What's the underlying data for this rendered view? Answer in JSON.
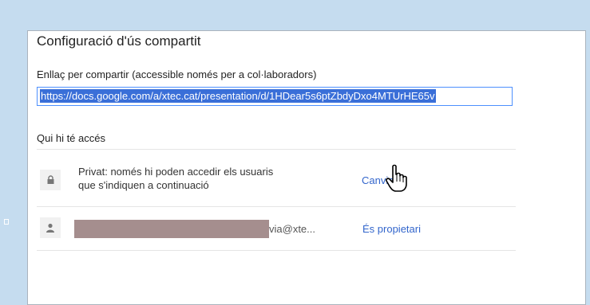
{
  "dialog": {
    "title": "Configuració d'ús compartit",
    "link_label": "Enllaç per compartir (accessible només per a col·laboradors)",
    "link_value": "https://docs.google.com/a/xtec.cat/presentation/d/1HDear5s6ptZbdyDxo4MTUrHE65v",
    "access_header": "Qui hi té accés",
    "privacy": {
      "icon": "lock-icon",
      "line1": "Privat: només hi poden accedir els usuaris",
      "line2": "que s'indiquen a continuació",
      "change_label": "Canvia"
    },
    "user": {
      "icon": "person-icon",
      "email_partial": "via@xte...",
      "role": "És propietari"
    }
  },
  "colors": {
    "background": "#c5dcef",
    "link": "#3366cc",
    "selection": "#3a6fd8",
    "redaction": "#a58e8e"
  }
}
